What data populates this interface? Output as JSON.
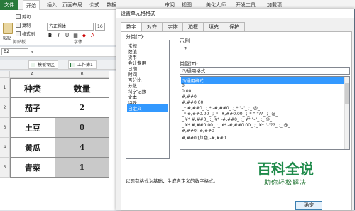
{
  "ribbon_tabs": [
    "文件",
    "开始",
    "插入",
    "页面布局",
    "公式",
    "数据",
    "审阅",
    "视图",
    "美化大师",
    "开发工具",
    "加载项"
  ],
  "ribbon": {
    "paste": "粘贴",
    "cut": "剪切",
    "copy": "复制",
    "format_painter": "格式刷",
    "clipboard_group": "剪贴板",
    "font_group": "字体",
    "font_name": "方正粗体",
    "font_size": "16"
  },
  "name_box": "B2",
  "sheet_tabs": [
    "模板专区",
    "工作簿1"
  ],
  "sheet": {
    "columns": [
      "A",
      "B"
    ],
    "rows": [
      "1",
      "2",
      "3",
      "4",
      "5"
    ],
    "header": [
      "种类",
      "数量"
    ],
    "data": [
      [
        "茄子",
        "2"
      ],
      [
        "土豆",
        "0"
      ],
      [
        "黄瓜",
        "4"
      ],
      [
        "青菜",
        "1"
      ]
    ]
  },
  "dialog": {
    "title": "设置单元格格式",
    "tabs": [
      "数字",
      "对齐",
      "字体",
      "边框",
      "填充",
      "保护"
    ],
    "category_label": "分类(C):",
    "categories": [
      "常规",
      "数值",
      "货币",
      "会计专用",
      "日期",
      "时间",
      "百分比",
      "分数",
      "科学记数",
      "文本",
      "特殊",
      "自定义"
    ],
    "selected_category": "自定义",
    "sample_label": "示例",
    "sample_value": "2",
    "type_label": "类型(T):",
    "type_value": "G/通用格式",
    "formats": [
      "G/通用格式",
      "0",
      "0.00",
      "#,##0",
      "#,##0.00",
      "_* #,##0_ ;_* -#,##0_ ;_* \"-\"_ ;_ @_",
      "_* #,##0.00_ ;_* -#,##0.00_ ;_* \"-\"??_ ;_ @_",
      "_ ¥* #,##0_ ;_ ¥* -#,##0_ ;_ ¥* \"-\"_ ;_ @_",
      "_ ¥* #,##0.00_ ;_ ¥* -#,##0.00_ ;_ ¥* \"-\"??_ ;_ @_",
      "#,##0;-#,##0",
      "#,##0;[红色]-#,##0"
    ],
    "description": "以现有格式为基础，生成自定义的数字格式。",
    "ok_label": "确定"
  },
  "watermark": {
    "main": "百科全说",
    "sub": "助你轻松解决"
  },
  "colors": {
    "file_tab": "#2a7a3b",
    "selection": "#3399ff",
    "watermark": "#1e8a4a"
  }
}
